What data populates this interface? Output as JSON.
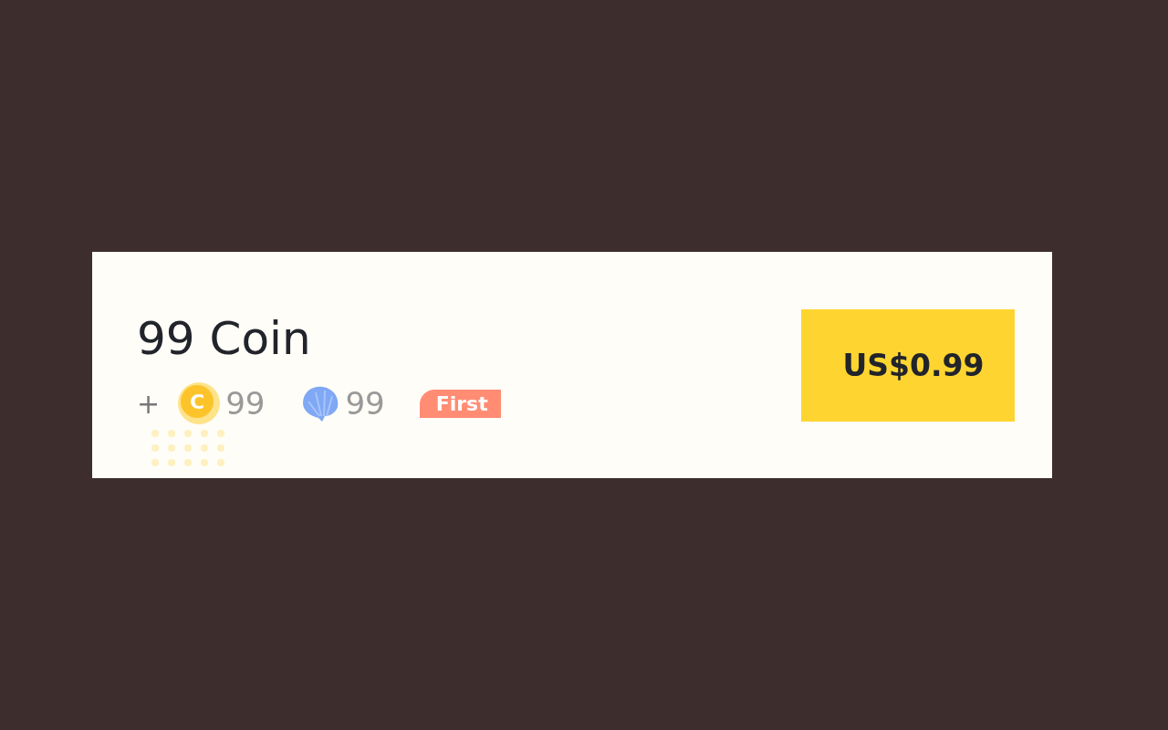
{
  "product": {
    "title": "99 Coin",
    "plus": "+",
    "bonuses": [
      {
        "kind": "coin",
        "symbol": "C",
        "amount": "99"
      },
      {
        "kind": "shell",
        "amount": "99"
      }
    ],
    "badge": "First"
  },
  "buy_button": {
    "label": "US$0.99"
  }
}
